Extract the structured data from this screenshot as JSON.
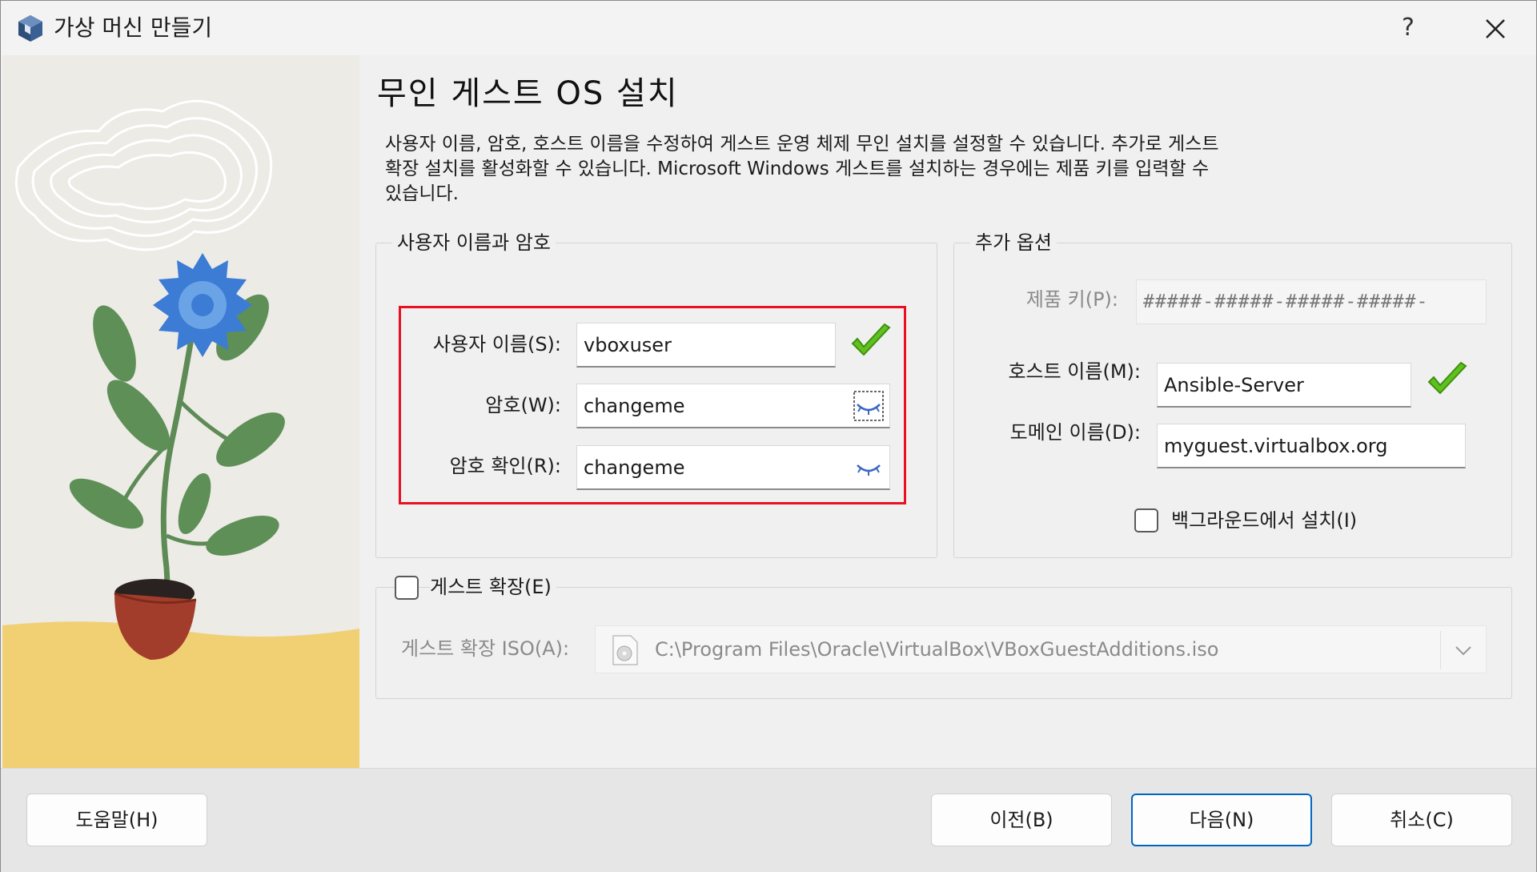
{
  "window": {
    "title": "가상 머신 만들기",
    "help_label": "?"
  },
  "page": {
    "title": "무인 게스트 OS 설치",
    "description_lines": [
      "사용자 이름, 암호, 호스트 이름을 수정하여 게스트 운영 체제 무인 설치를 설정할 수 있습니다. 추가로 게스트",
      "확장 설치를 활성화할 수 있습니다. Microsoft Windows 게스트를 설치하는 경우에는 제품 키를 입력할 수",
      "있습니다."
    ]
  },
  "credentials": {
    "group_title": "사용자 이름과 암호",
    "username_label": "사용자 이름(S):",
    "username_value": "vboxuser",
    "password_label": "암호(W):",
    "password_value": "changeme",
    "confirm_label": "암호 확인(R):",
    "confirm_value": "changeme"
  },
  "extra": {
    "group_title": "추가 옵션",
    "product_key_label": "제품 키(P):",
    "product_key_placeholder": "#####-#####-#####-#####-",
    "hostname_label": "호스트 이름(M):",
    "hostname_value": "Ansible-Server",
    "domain_label": "도메인 이름(D):",
    "domain_value": "myguest.virtualbox.org",
    "background_install_label": "백그라운드에서 설치(I)",
    "background_install_checked": false
  },
  "guest_additions": {
    "checkbox_label": "게스트 확장(E)",
    "checked": false,
    "iso_label": "게스트 확장 ISO(A):",
    "iso_path": "C:\\Program Files\\Oracle\\VirtualBox\\VBoxGuestAdditions.iso"
  },
  "buttons": {
    "help": "도움말(H)",
    "back": "이전(B)",
    "next": "다음(N)",
    "cancel": "취소(C)"
  },
  "colors": {
    "accent": "#0067c0",
    "highlight": "#e81123",
    "valid_check": "#5fc11e",
    "eye": "#3a66c4"
  }
}
